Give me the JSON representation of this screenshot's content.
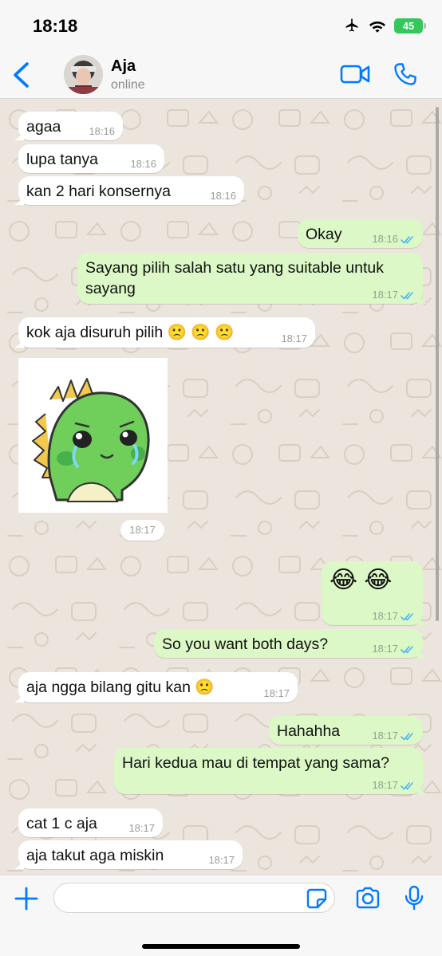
{
  "status_bar": {
    "time": "18:18",
    "battery": "45"
  },
  "header": {
    "contact_name": "Aja",
    "contact_status": "online"
  },
  "messages": [
    {
      "dir": "in",
      "text": "agaa",
      "time": "18:16"
    },
    {
      "dir": "in",
      "text": "lupa tanya",
      "time": "18:16"
    },
    {
      "dir": "in",
      "text": "kan 2 hari konsernya",
      "time": "18:16"
    },
    {
      "dir": "out",
      "text": "Okay",
      "time": "18:16",
      "read": true
    },
    {
      "dir": "out",
      "text_line1": "Sayang pilih salah satu yang suitable untuk",
      "text_line2": "sayang",
      "time": "18:17",
      "read": true
    },
    {
      "dir": "in",
      "text": "kok aja disuruh pilih 🙁 🙁 🙁",
      "time": "18:17"
    },
    {
      "dir": "in",
      "type": "sticker",
      "time": "18:17",
      "sticker": "crying-green-dinosaur"
    },
    {
      "dir": "out",
      "text": "😂 😂",
      "time": "18:17",
      "read": true
    },
    {
      "dir": "out",
      "text": "So you want both days?",
      "time": "18:17",
      "read": true
    },
    {
      "dir": "in",
      "text": "aja ngga bilang gitu kan 🙁",
      "time": "18:17"
    },
    {
      "dir": "out",
      "text": "Hahahha",
      "time": "18:17",
      "read": true
    },
    {
      "dir": "out",
      "text": "Hari kedua mau di tempat yang sama?",
      "time": "18:17",
      "read": true
    },
    {
      "dir": "in",
      "text": "cat 1 c aja",
      "time": "18:17"
    },
    {
      "dir": "in",
      "text": "aja takut aga miskin",
      "time": "18:17"
    }
  ],
  "input": {
    "placeholder": "",
    "value": ""
  },
  "colors": {
    "accent": "#007aff",
    "incoming": "#ffffff",
    "outgoing": "#dcf8c6",
    "chat_bg": "#ece5dd",
    "read_ticks": "#4fb6ec"
  }
}
